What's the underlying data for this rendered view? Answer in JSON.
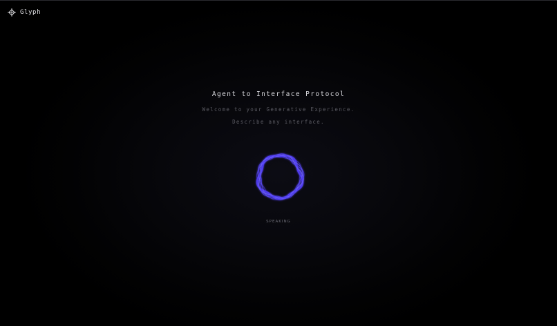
{
  "brand": {
    "name": "Glyph",
    "icon": "crosshair-diamond-icon"
  },
  "hero": {
    "title": "Agent to Interface Protocol",
    "subtitle": "Welcome to your Generative Experience.",
    "prompt": "Describe any interface."
  },
  "voice": {
    "status": "SPEAKING",
    "icon": "voice-orb-icon",
    "accent_color": "#4f3cf0",
    "highlight_color": "#6a5cff"
  }
}
